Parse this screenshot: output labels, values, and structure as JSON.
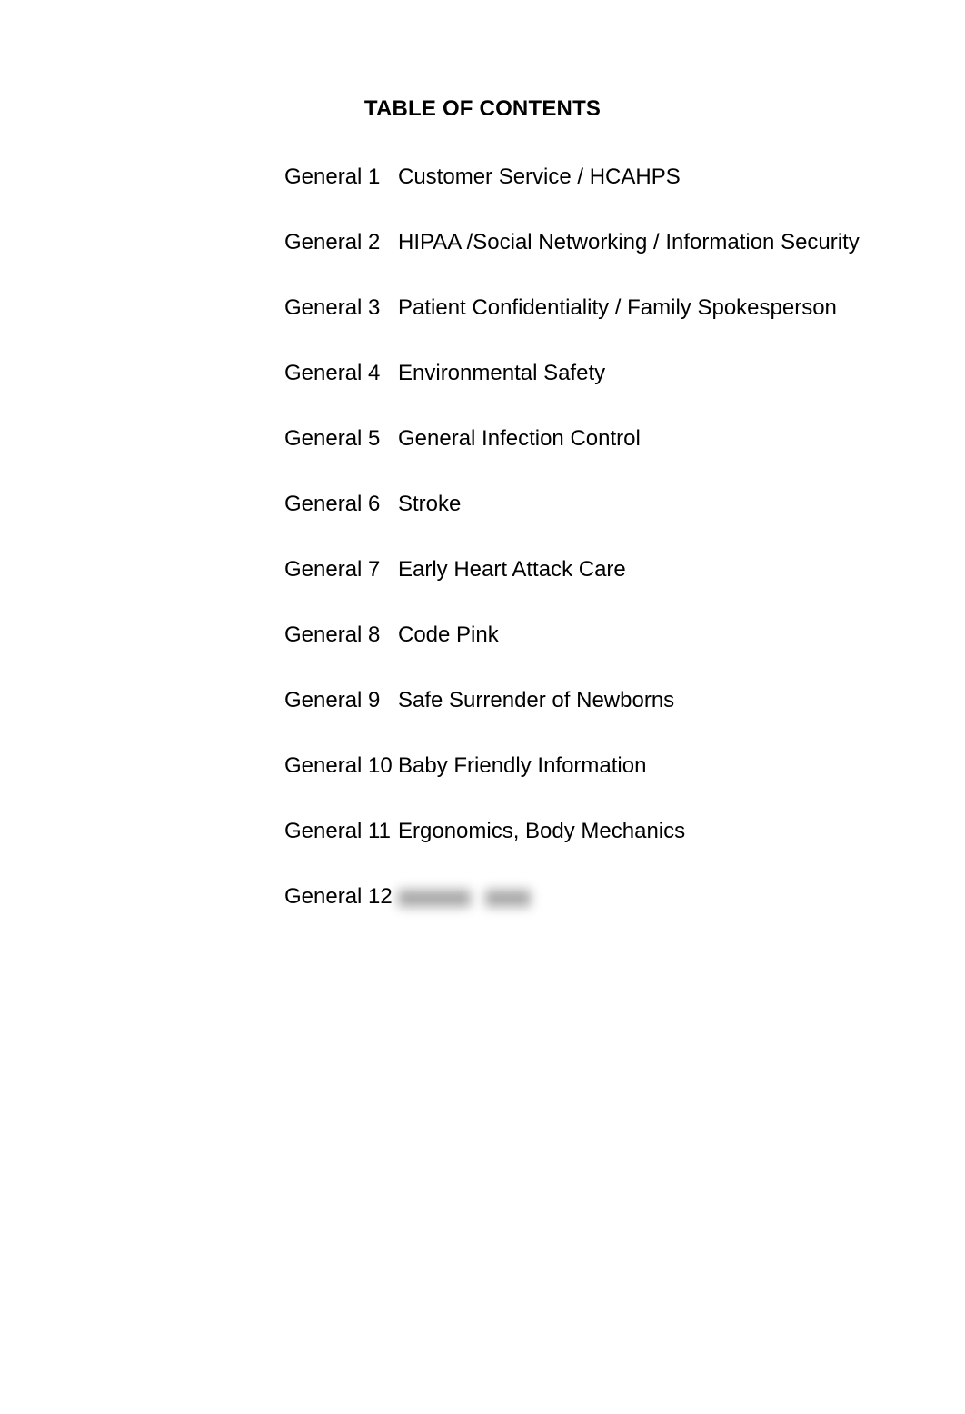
{
  "document": {
    "heading": "TABLE OF CONTENTS",
    "background_color": "#ffffff",
    "text_color": "#000000"
  },
  "toc": {
    "entries": [
      {
        "label": "General 1",
        "title": "Customer Service / HCAHPS",
        "redacted": false
      },
      {
        "label": "General 2",
        "title": "HIPAA /Social Networking / Information Security",
        "redacted": false
      },
      {
        "label": "General 3",
        "title": "Patient Confidentiality / Family Spokesperson",
        "redacted": false
      },
      {
        "label": "General 4",
        "title": "Environmental Safety",
        "redacted": false
      },
      {
        "label": "General 5",
        "title": "General Infection Control",
        "redacted": false
      },
      {
        "label": "General 6",
        "title": "Stroke",
        "redacted": false
      },
      {
        "label": "General 7",
        "title": "Early Heart Attack Care",
        "redacted": false
      },
      {
        "label": "General 8",
        "title": "Code Pink",
        "redacted": false
      },
      {
        "label": "General 9",
        "title": "Safe Surrender of Newborns",
        "redacted": false
      },
      {
        "label": "General 10",
        "title": "Baby Friendly Information",
        "redacted": false
      },
      {
        "label": "General 11",
        "title": "Ergonomics, Body Mechanics",
        "redacted": false
      },
      {
        "label": "General 12",
        "title": "",
        "redacted": true
      }
    ]
  }
}
